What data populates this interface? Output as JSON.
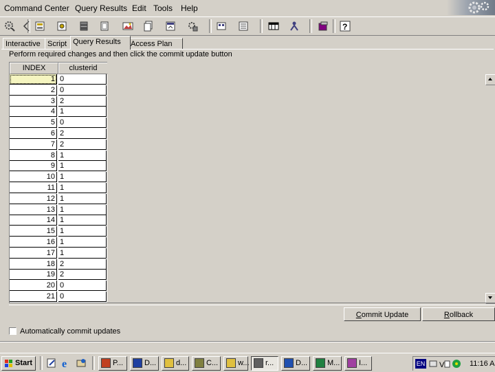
{
  "menu": [
    "Command Center",
    "Query Results",
    "Edit",
    "Tools",
    "Help"
  ],
  "toolbar": {
    "icons": [
      "gear-connect-icon",
      "back-arrow-icon",
      "command-center-icon",
      "script-center-icon",
      "journal-icon",
      "alert-center-icon",
      "license-center-icon",
      "dev-center-icon",
      "tools-settings-icon",
      "task-center-icon",
      "information-center-icon",
      "replication-center-icon",
      "satellite-admin-icon",
      "contacts-icon",
      "help-icon"
    ]
  },
  "tabs": [
    "Interactive",
    "Script",
    "Query Results",
    "Access Plan"
  ],
  "active_tab": "Query Results",
  "instruction": "Perform required changes and then click the commit update button",
  "grid": {
    "columns": [
      "INDEX",
      "clusterid"
    ],
    "rows": [
      [
        "1",
        "0"
      ],
      [
        "2",
        "0"
      ],
      [
        "3",
        "2"
      ],
      [
        "4",
        "1"
      ],
      [
        "5",
        "0"
      ],
      [
        "6",
        "2"
      ],
      [
        "7",
        "2"
      ],
      [
        "8",
        "1"
      ],
      [
        "9",
        "1"
      ],
      [
        "10",
        "1"
      ],
      [
        "11",
        "1"
      ],
      [
        "12",
        "1"
      ],
      [
        "13",
        "1"
      ],
      [
        "14",
        "1"
      ],
      [
        "15",
        "1"
      ],
      [
        "16",
        "1"
      ],
      [
        "17",
        "1"
      ],
      [
        "18",
        "2"
      ],
      [
        "19",
        "2"
      ],
      [
        "20",
        "0"
      ],
      [
        "21",
        "0"
      ]
    ]
  },
  "buttons": {
    "commit": "Commit Update",
    "commit_mnemonic": "C",
    "commit_rest": "ommit Update",
    "rollback": "Rollback",
    "rollback_mnemonic": "R",
    "rollback_rest": "ollback"
  },
  "autocommit": {
    "label": "Automatically commit updates",
    "checked": false
  },
  "taskbar": {
    "start": "Start",
    "tasks": [
      {
        "label": "P...",
        "icon": "powerpoint-icon"
      },
      {
        "label": "D...",
        "icon": "db2-icon"
      },
      {
        "label": "d...",
        "icon": "folder-icon"
      },
      {
        "label": "C...",
        "icon": "control-center-icon"
      },
      {
        "label": "w...",
        "icon": "folder-icon"
      },
      {
        "label": "r...",
        "icon": "command-center-icon",
        "active": true
      },
      {
        "label": "D...",
        "icon": "word-icon"
      },
      {
        "label": "M...",
        "icon": "excel-icon"
      },
      {
        "label": "I...",
        "icon": "info-icon"
      }
    ],
    "tray_lang": "EN",
    "clock": "11:16 AM"
  },
  "colors": {
    "face": "#d4d0c8",
    "shadow": "#808080",
    "highlight": "#ffffff",
    "tray_lang_bg": "#00007f"
  }
}
